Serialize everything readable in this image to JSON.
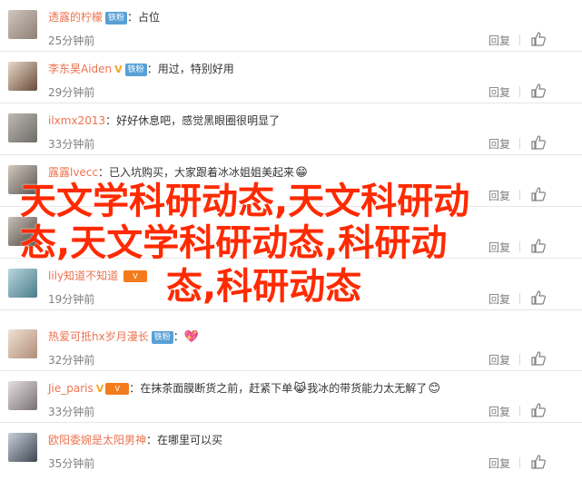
{
  "comments": [
    {
      "user": "透露的柠檬",
      "badge": "铁粉",
      "vip": "",
      "text": "占位",
      "time": "25分钟前",
      "reply": "回复",
      "likes": "",
      "emoji": ""
    },
    {
      "user": "李东昊Aiden",
      "badge": "铁粉",
      "vip": "V",
      "text": "用过，特别好用",
      "time": "29分钟前",
      "reply": "回复",
      "likes": "",
      "emoji": ""
    },
    {
      "user": "ilxmx2013",
      "badge": "",
      "vip": "",
      "text": "好好休息吧，感觉黑眼圈很明显了",
      "time": "33分钟前",
      "reply": "回复",
      "likes": "",
      "emoji": ""
    },
    {
      "user": "露露lvecc",
      "badge": "",
      "vip": "",
      "text": "已入坑购买，大家跟着冰冰姐姐美起来",
      "time": "",
      "reply": "回复",
      "likes": "",
      "emoji": "😁"
    },
    {
      "user": "",
      "badge": "",
      "vip": "",
      "text": "",
      "time": "",
      "reply": "回复",
      "likes": "",
      "emoji": ""
    },
    {
      "user": "lily知道不知道",
      "badge": "",
      "vip": "",
      "text": "",
      "time": "19分钟前",
      "reply": "回复",
      "likes": "",
      "emoji": ""
    },
    {
      "user": "热爱可抵hx岁月漫长",
      "badge": "铁粉",
      "vip": "",
      "text": "",
      "time": "32分钟前",
      "reply": "回复",
      "likes": "",
      "emoji": "💖"
    },
    {
      "user": "Jie_paris",
      "badge": "",
      "vip": "V",
      "text": "在抹茶面膜断货之前，赶紧下单",
      "text2": "我冰的带货能力太无解了",
      "time": "33分钟前",
      "reply": "回复",
      "likes": "",
      "emoji": "😹",
      "emoji2": "😊"
    },
    {
      "user": "欧阳委婉是太阳男神",
      "badge": "",
      "vip": "",
      "text": "在哪里可以买",
      "time": "35分钟前",
      "reply": "回复",
      "likes": "",
      "emoji": ""
    }
  ],
  "overlay": {
    "line1": "天文学科研动态,天文科研动",
    "line2": "态,天文学科研动态,科研动",
    "line3": "态,科研动态"
  },
  "colors": {
    "username": "#eb7350",
    "overlay": "#ff2a00",
    "badge": "#57a0d6"
  }
}
